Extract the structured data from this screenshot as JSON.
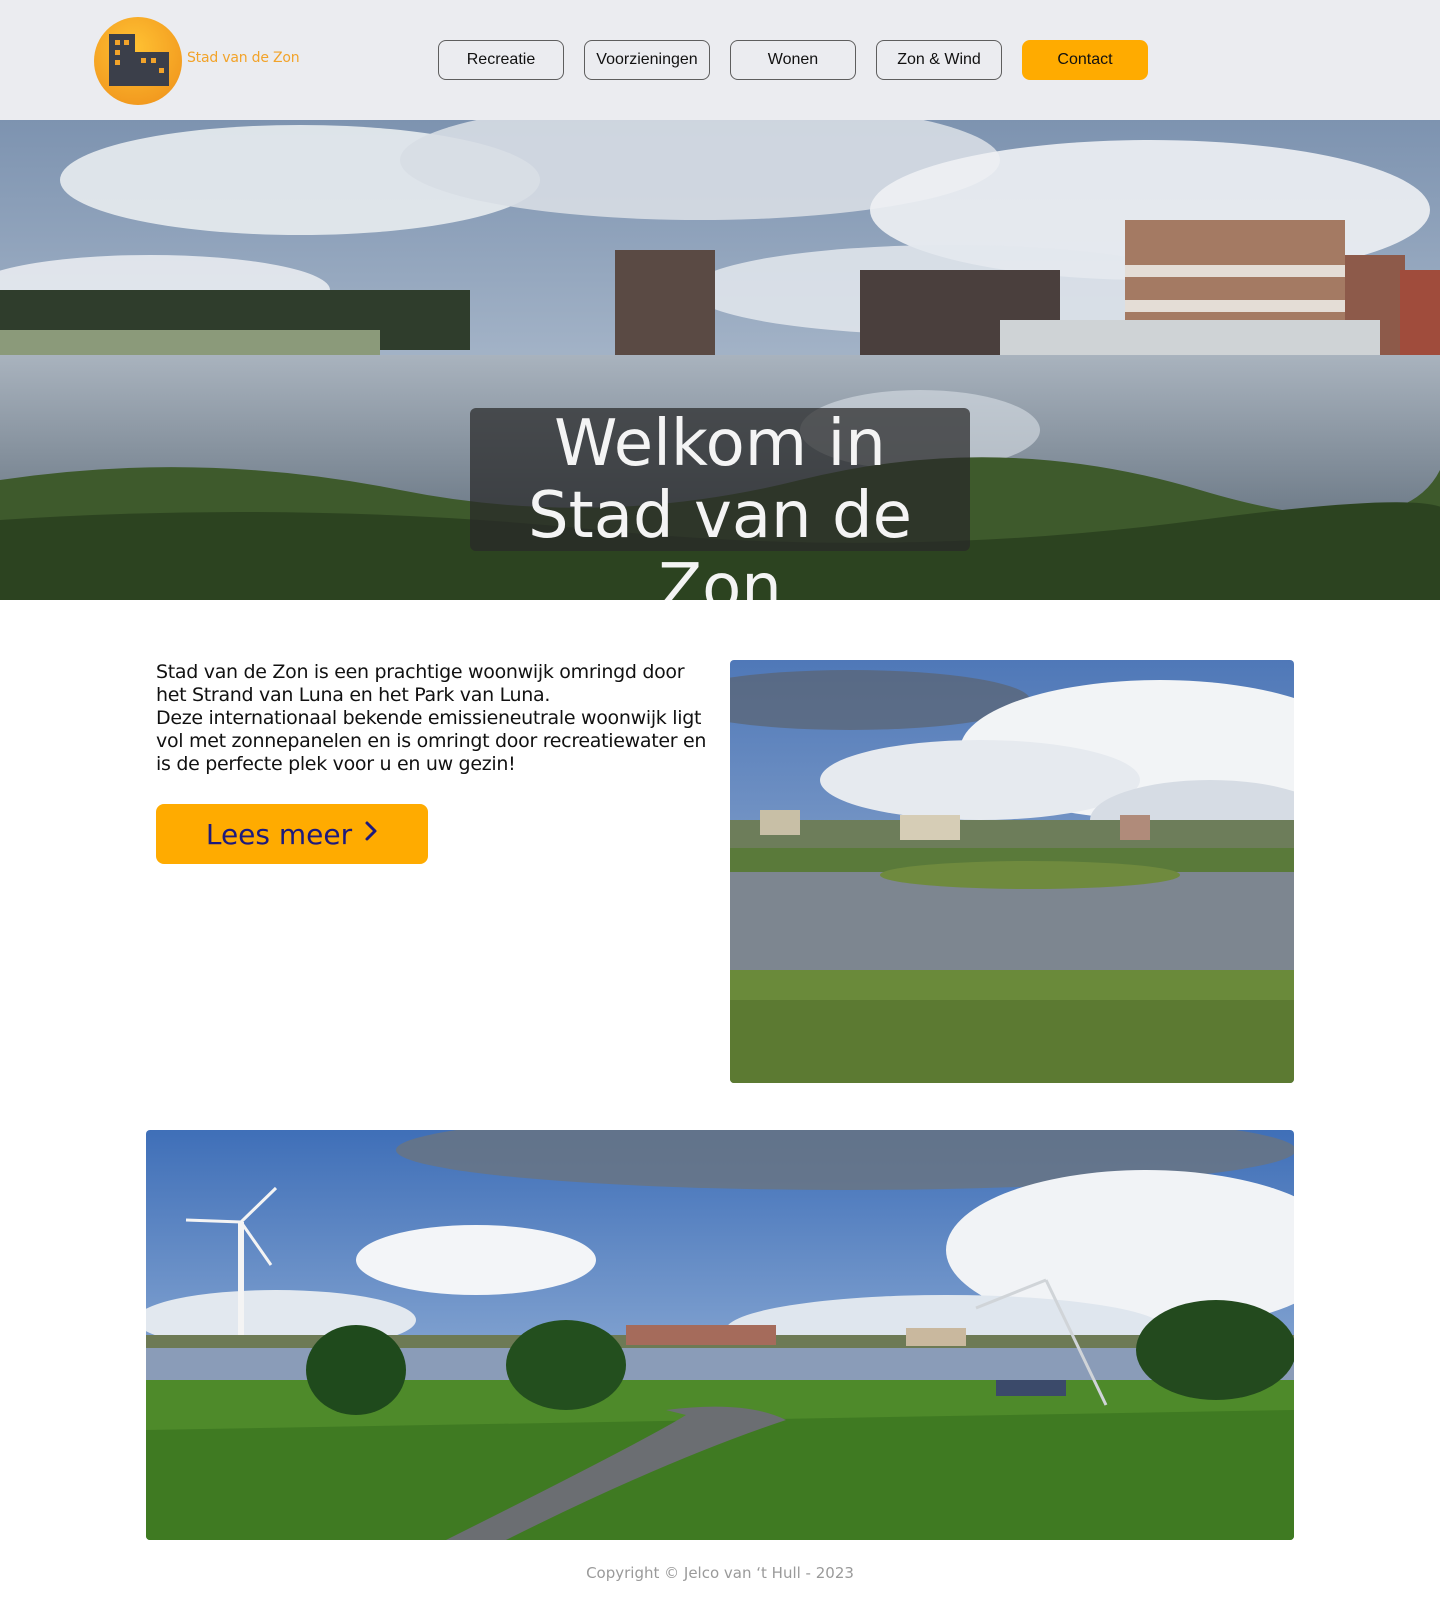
{
  "brand": {
    "name": "Stad van de Zon",
    "accent": "#ffab00",
    "logo_dark": "#3b3f4a"
  },
  "nav": [
    {
      "label": "Recreatie"
    },
    {
      "label": "Voorzieningen"
    },
    {
      "label": "Wonen"
    },
    {
      "label": "Zon & Wind"
    },
    {
      "label": "Contact"
    }
  ],
  "hero": {
    "line1": "Welkom in",
    "line2": "Stad van de Zon"
  },
  "intro": {
    "text": "Stad van de Zon is een prachtige woonwijk omringd door het Strand van Luna en het Park van Luna.",
    "text2": "Deze internationaal bekende emissieneutrale woonwijk ligt vol met zonnepanelen en is omringt door recreatiewater en is de perfecte plek voor u en uw gezin!",
    "button": "Lees meer",
    "button_icon": "chevron-right-icon"
  },
  "footer": {
    "copyright": "Copyright © Jelco van ‘t Hull - 2023"
  }
}
